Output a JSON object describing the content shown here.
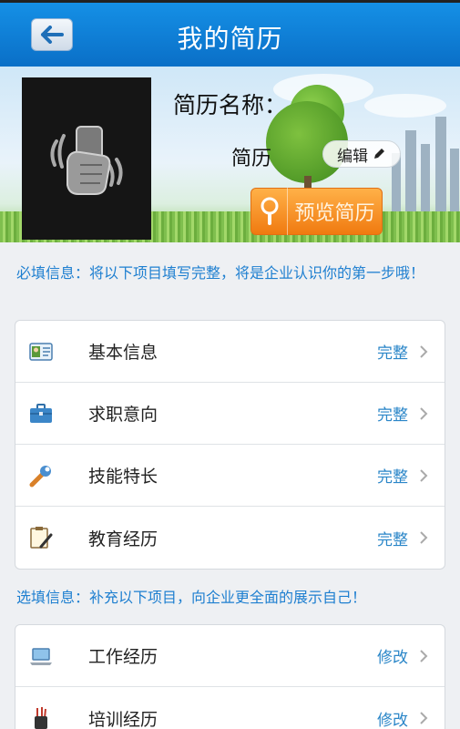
{
  "header": {
    "title": "我的简历"
  },
  "profile": {
    "name_label": "简历名称：",
    "name_value": "简历",
    "edit_label": "编辑",
    "preview_label": "预览简历"
  },
  "required": {
    "note": "必填信息：将以下项目填写完整，将是企业认识你的第一步哦！",
    "items": [
      {
        "label": "基本信息",
        "status": "完整",
        "icon": "id-card-icon"
      },
      {
        "label": "求职意向",
        "status": "完整",
        "icon": "briefcase-icon"
      },
      {
        "label": "技能特长",
        "status": "完整",
        "icon": "wrench-icon"
      },
      {
        "label": "教育经历",
        "status": "完整",
        "icon": "clipboard-pen-icon"
      }
    ]
  },
  "optional": {
    "note": "选填信息：补充以下项目，向企业更全面的展示自己！",
    "items": [
      {
        "label": "工作经历",
        "status": "修改",
        "icon": "laptop-icon"
      },
      {
        "label": "培训经历",
        "status": "修改",
        "icon": "pencil-cup-icon"
      }
    ]
  },
  "colors": {
    "header": "#0a6fc7",
    "accent": "#1e7fd0",
    "status": "#2a86c8",
    "preview": "#f07a10"
  }
}
